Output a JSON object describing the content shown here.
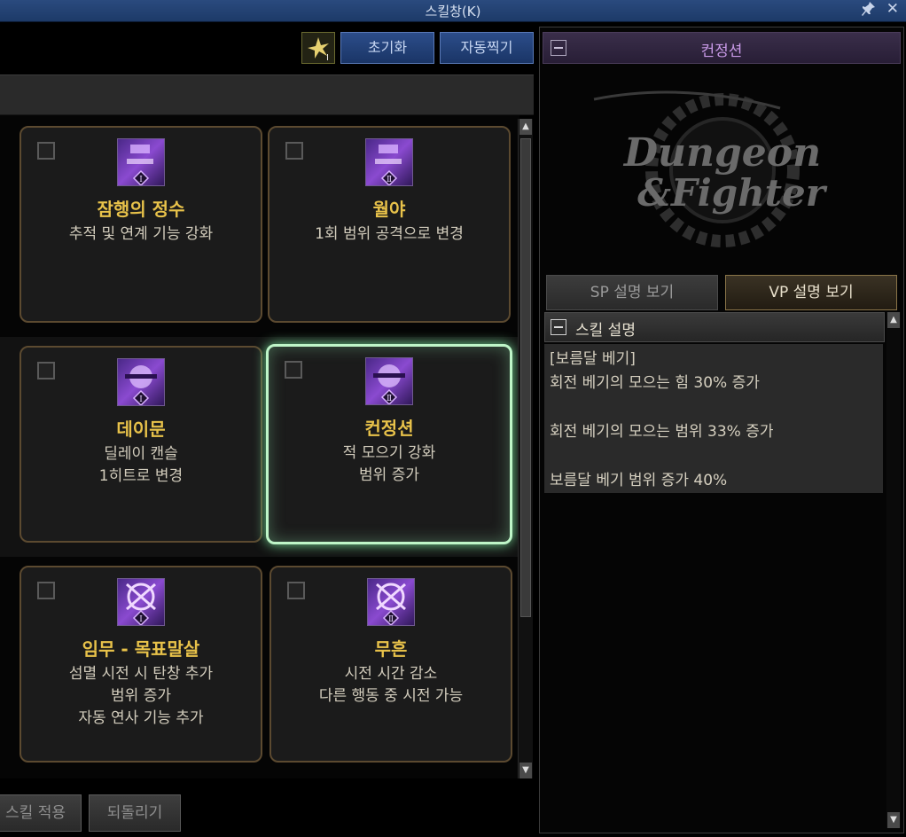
{
  "window": {
    "title": "스킬창(K)",
    "pin_icon": "pin-icon",
    "close_icon": "close-icon",
    "close_glyph": "✕",
    "pin_glyph": "📌"
  },
  "toolbar": {
    "reset_label": "초기화",
    "auto_label": "자동찍기",
    "star_icon": "star-burst-icon"
  },
  "cards": [
    {
      "name": "잠행의 정수",
      "desc1": "추적 및 연계 기능 강화",
      "desc2": "",
      "desc3": "",
      "tier": "Ⅰ"
    },
    {
      "name": "월야",
      "desc1": "1회 범위 공격으로 변경",
      "desc2": "",
      "desc3": "",
      "tier": "Ⅱ"
    },
    {
      "name": "데이문",
      "desc1": "딜레이 캔슬",
      "desc2": "1히트로 변경",
      "desc3": "",
      "tier": "Ⅰ"
    },
    {
      "name": "컨정션",
      "desc1": "적 모으기 강화",
      "desc2": "범위 증가",
      "desc3": "",
      "tier": "Ⅱ"
    },
    {
      "name": "임무 - 목표말살",
      "desc1": "섬멸 시전 시 탄창 추가",
      "desc2": "범위 증가",
      "desc3": "자동 연사 기능 추가",
      "tier": "Ⅰ"
    },
    {
      "name": "무흔",
      "desc1": "시전 시간 감소",
      "desc2": "다른 행동 중 시전 가능",
      "desc3": "",
      "tier": "Ⅱ"
    }
  ],
  "bottom": {
    "apply_label": "스킬 적용",
    "revert_label": "되돌리기"
  },
  "right": {
    "header_title": "컨정션",
    "tab_sp": "SP 설명 보기",
    "tab_vp": "VP 설명 보기",
    "section_title": "스킬 설명",
    "lines": [
      "[보름달 베기]",
      "회전 베기의 모으는 힘 30% 증가",
      "회전 베기의 모으는 범위 33% 증가",
      "보름달 베기 범위 증가 40%"
    ]
  },
  "colors": {
    "accent_gold": "#e8c24a",
    "selected_glow": "#bff5c8",
    "header_purple": "#c99ae8"
  }
}
